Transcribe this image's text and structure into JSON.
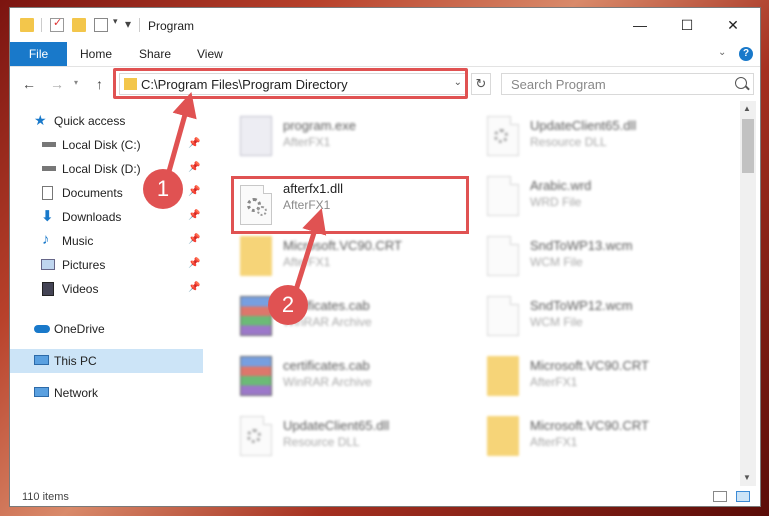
{
  "window": {
    "title": "Program",
    "ribbon_tabs": {
      "file": "File",
      "home": "Home",
      "share": "Share",
      "view": "View"
    },
    "controls": {
      "minimize": "—",
      "maximize": "☐",
      "close": "✕"
    }
  },
  "nav": {
    "address": "C:\\Program Files\\Program Directory",
    "search_placeholder": "Search Program",
    "refresh": "↻",
    "back": "←",
    "forward": "→",
    "up": "↑"
  },
  "sidebar": {
    "items": [
      {
        "label": "Quick access",
        "icon": "star-icon"
      },
      {
        "label": "Local Disk (C:)",
        "icon": "drive-icon"
      },
      {
        "label": "Local Disk (D:)",
        "icon": "drive-icon"
      },
      {
        "label": "Documents",
        "icon": "documents-icon"
      },
      {
        "label": "Downloads",
        "icon": "download-icon"
      },
      {
        "label": "Music",
        "icon": "music-icon"
      },
      {
        "label": "Pictures",
        "icon": "pictures-icon"
      },
      {
        "label": "Videos",
        "icon": "videos-icon"
      },
      {
        "label": "OneDrive",
        "icon": "cloud-icon"
      },
      {
        "label": "This PC",
        "icon": "computer-icon"
      },
      {
        "label": "Network",
        "icon": "network-icon"
      }
    ]
  },
  "files": [
    {
      "name": "program.exe",
      "type": "AfterFX1",
      "icon": "exe"
    },
    {
      "name": "UpdateClient65.dll",
      "type": "Resource DLL",
      "icon": "dll"
    },
    {
      "name": "afterfx1.dll",
      "type": "AfterFX1",
      "icon": "dll"
    },
    {
      "name": "Arabic.wrd",
      "type": "WRD File",
      "icon": "doc"
    },
    {
      "name": "Microsoft.VC90.CRT",
      "type": "AfterFX1",
      "icon": "folder"
    },
    {
      "name": "SndToWP13.wcm",
      "type": "WCM File",
      "icon": "doc"
    },
    {
      "name": "certificates.cab",
      "type": "WinRAR Archive",
      "icon": "rar"
    },
    {
      "name": "SndToWP12.wcm",
      "type": "WCM File",
      "icon": "doc"
    },
    {
      "name": "certificates.cab",
      "type": "WinRAR Archive",
      "icon": "rar"
    },
    {
      "name": "Microsoft.VC90.CRT",
      "type": "AfterFX1",
      "icon": "folder"
    },
    {
      "name": "UpdateClient65.dll",
      "type": "Resource DLL",
      "icon": "dll"
    },
    {
      "name": "Microsoft.VC90.CRT",
      "type": "AfterFX1",
      "icon": "folder"
    }
  ],
  "status": {
    "count": "110 items"
  },
  "callouts": {
    "one": "1",
    "two": "2"
  },
  "colors": {
    "accent": "#1979ca",
    "highlight": "#e05252",
    "selected": "#cce4f7"
  }
}
